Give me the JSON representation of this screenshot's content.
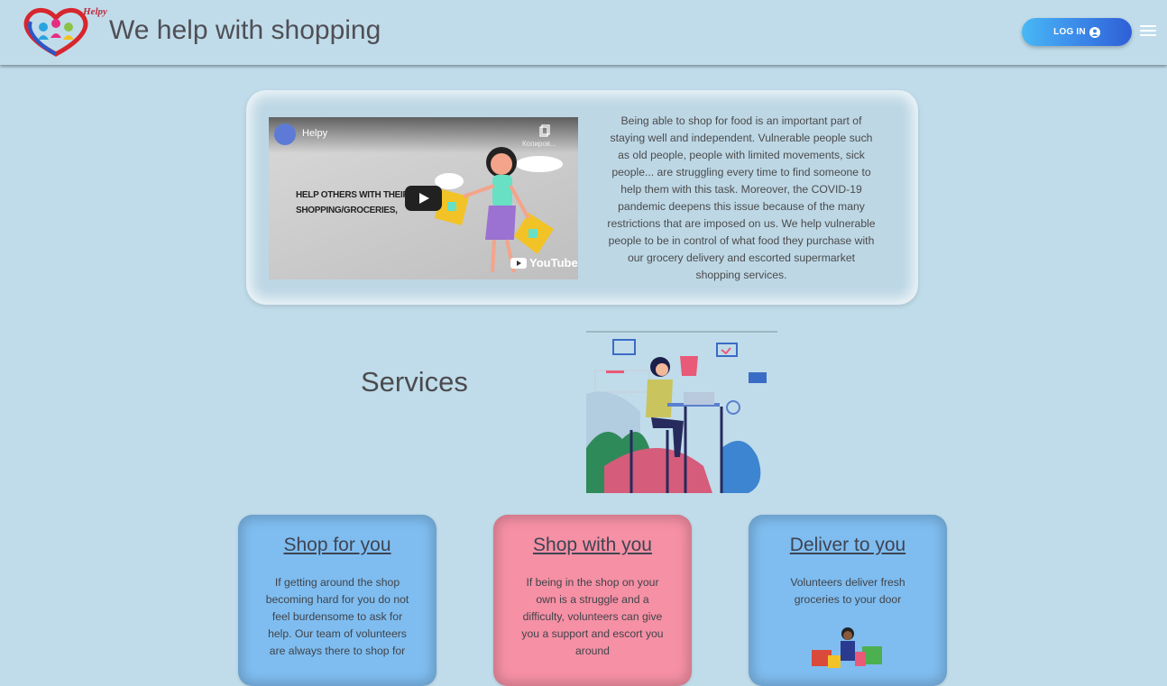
{
  "header": {
    "logo_text": "Helpy",
    "title": "We help with shopping",
    "login_label": "LOG IN",
    "login_icon": "user-circle-icon",
    "menu_icon": "hamburger-menu-icon"
  },
  "intro": {
    "video": {
      "channel": "Helpy",
      "copy_label": "Копиров...",
      "caption": "HELP OTHERS WITH THEIR SHOPPING/GROCERIES,",
      "platform": "YouTube"
    },
    "text": "Being able to shop for food is an important part of staying well and independent. Vulnerable people such as old people, people with limited movements, sick people... are struggling every time to find someone to help them with this task. Moreover, the COVID-19 pandemic deepens this issue because of the many restrictions that are imposed on us. We help vulnerable people to be in control of what food they purchase with our grocery delivery and escorted supermarket shopping services."
  },
  "services": {
    "heading": "Services",
    "cards": [
      {
        "title": "Shop for you",
        "text": "If getting around the shop becoming hard for you do not feel burdensome to ask for help. Our team of volunteers are always there to shop for",
        "color": "#7fbdf0"
      },
      {
        "title": "Shop with you",
        "text": "If being in the shop on your own is a struggle and a difficulty, volunteers can give you a support and escort you around",
        "color": "#f690a5"
      },
      {
        "title": "Deliver to you",
        "text": "Volunteers deliver fresh groceries to your door",
        "color": "#7fbdf0"
      }
    ]
  },
  "colors": {
    "background": "#c0dcea",
    "accent": "#3a86e8"
  }
}
